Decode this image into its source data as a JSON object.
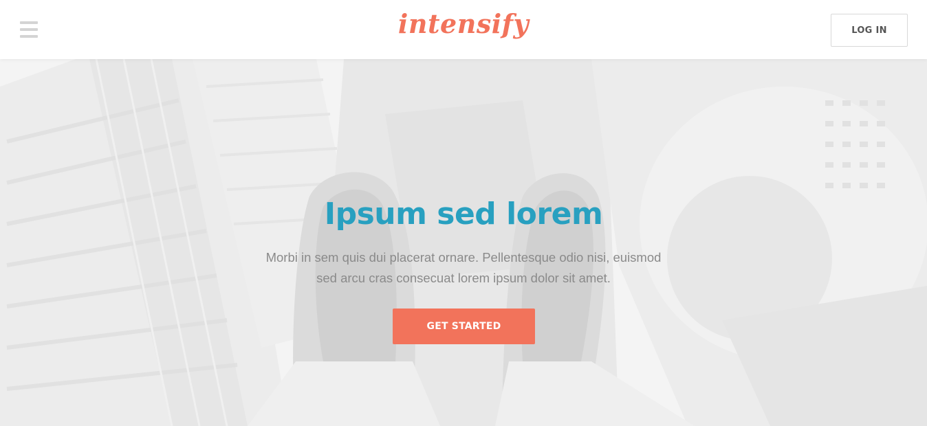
{
  "header": {
    "menu_icon": "hamburger-menu-icon",
    "logo_text": "intensify",
    "login_label": "LOG IN"
  },
  "hero": {
    "background": "aerial-city-feet-photo",
    "title": "Ipsum sed lorem",
    "subtitle": "Morbi in sem quis dui placerat ornare. Pellentesque odio nisi, euismod sed arcu cras consecuat lorem ipsum dolor sit amet.",
    "cta_label": "GET STARTED"
  },
  "colors": {
    "accent": "#f2735b",
    "title": "#28a0c0",
    "body_text": "#8a8a8a"
  }
}
